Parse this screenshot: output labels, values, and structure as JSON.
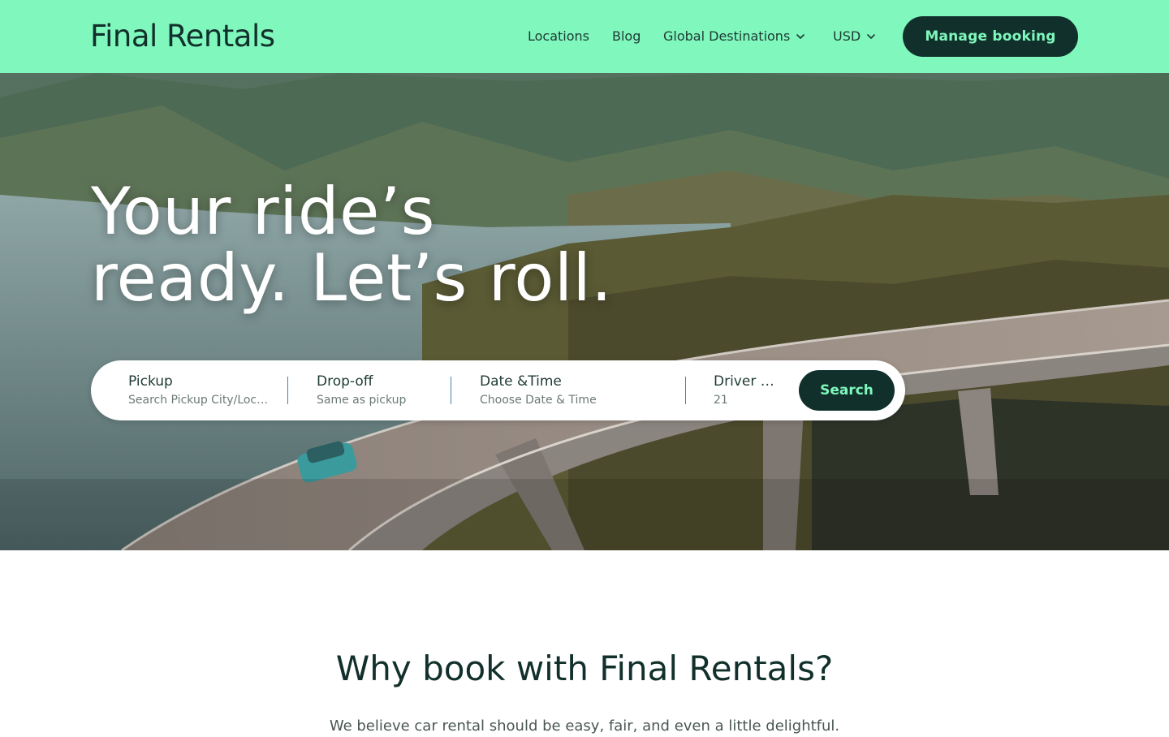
{
  "header": {
    "logo": "Final Rentals",
    "nav": {
      "locations": "Locations",
      "blog": "Blog",
      "global_destinations": "Global Destinations",
      "currency": "USD"
    },
    "manage_booking": "Manage booking"
  },
  "hero": {
    "title_line1": "Your ride’s",
    "title_line2": "ready. Let’s roll."
  },
  "search": {
    "pickup": {
      "label": "Pickup",
      "placeholder": "Search Pickup City/Location"
    },
    "dropoff": {
      "label": "Drop-off",
      "value": "Same as pickup"
    },
    "datetime": {
      "label": "Date &Time",
      "placeholder": "Choose Date & Time"
    },
    "driver": {
      "label": "Driver age",
      "value": "21"
    },
    "button": "Search"
  },
  "why": {
    "title": "Why book with Final Rentals?",
    "subtitle": "We believe car rental should be easy, fair, and even a little delightful."
  },
  "colors": {
    "brand_mint": "#7ff7bd",
    "brand_dark": "#12302b"
  },
  "icons": {
    "global_chevron": "chevron-down-icon",
    "currency_chevron": "chevron-down-icon"
  }
}
